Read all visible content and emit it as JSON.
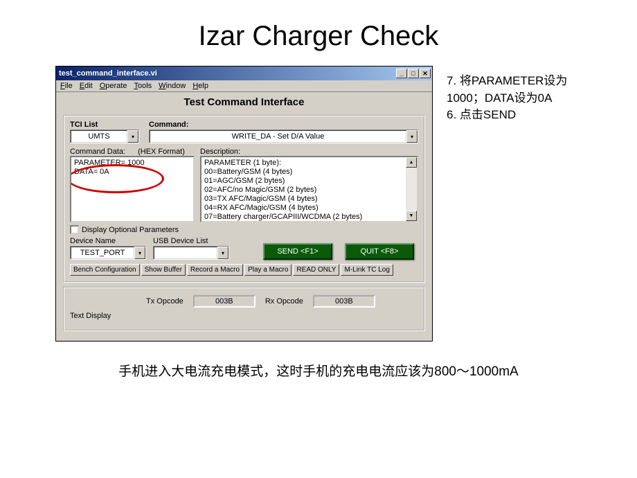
{
  "slide": {
    "title": "Izar Charger Check",
    "bottom_text": "手机进入大电流充电模式，这时手机的充电电流应该为800～1000mA"
  },
  "instructions": {
    "line1": "7. 将PARAMETER设为1000；DATA设为0A",
    "line2": "6. 点击SEND"
  },
  "window": {
    "title": "test_command_interface.vi",
    "menu": {
      "file": "File",
      "edit": "Edit",
      "operate": "Operate",
      "tools": "Tools",
      "window": "Window",
      "help": "Help"
    },
    "app_title": "Test Command Interface",
    "tci_label": "TCI List",
    "tci_value": "UMTS",
    "command_label": "Command:",
    "command_value": "WRITE_DA - Set D/A Value",
    "cmddata_label": "Command Data:",
    "hex_label": "(HEX Format)",
    "cmddata_line1": "PARAMETER= 1000",
    "cmddata_line2": "DATA= 0A",
    "desc_label": "Description:",
    "desc_lines": {
      "l1": "PARAMETER (1 byte):",
      "l2": "00=Battery/GSM (4 bytes)",
      "l3": "01=AGC/GSM (2 bytes)",
      "l4": "02=AFC/no Magic/GSM (2 bytes)",
      "l5": "03=TX AFC/Magic/GSM (4 bytes)",
      "l6": "04=RX AFC/Magic/GSM (4 bytes)",
      "l7": "07=Battery charger/GCAPIII/WCDMA (2 bytes)"
    },
    "display_optional": "Display Optional Parameters",
    "devname_label": "Device Name",
    "devname_value": "TEST_PORT",
    "usb_label": "USB Device List",
    "send_btn": "SEND <F1>",
    "quit_btn": "QUIT <F8>",
    "buttons": {
      "b1": "Bench Configuration",
      "b2": "Show Buffer",
      "b3": "Record a Macro",
      "b4": "Play a Macro",
      "b5": "READ ONLY",
      "b6": "M-Link TC Log"
    },
    "tx_label": "Tx Opcode",
    "tx_value": "003B",
    "rx_label": "Rx Opcode",
    "rx_value": "003B",
    "text_display": "Text Display"
  }
}
